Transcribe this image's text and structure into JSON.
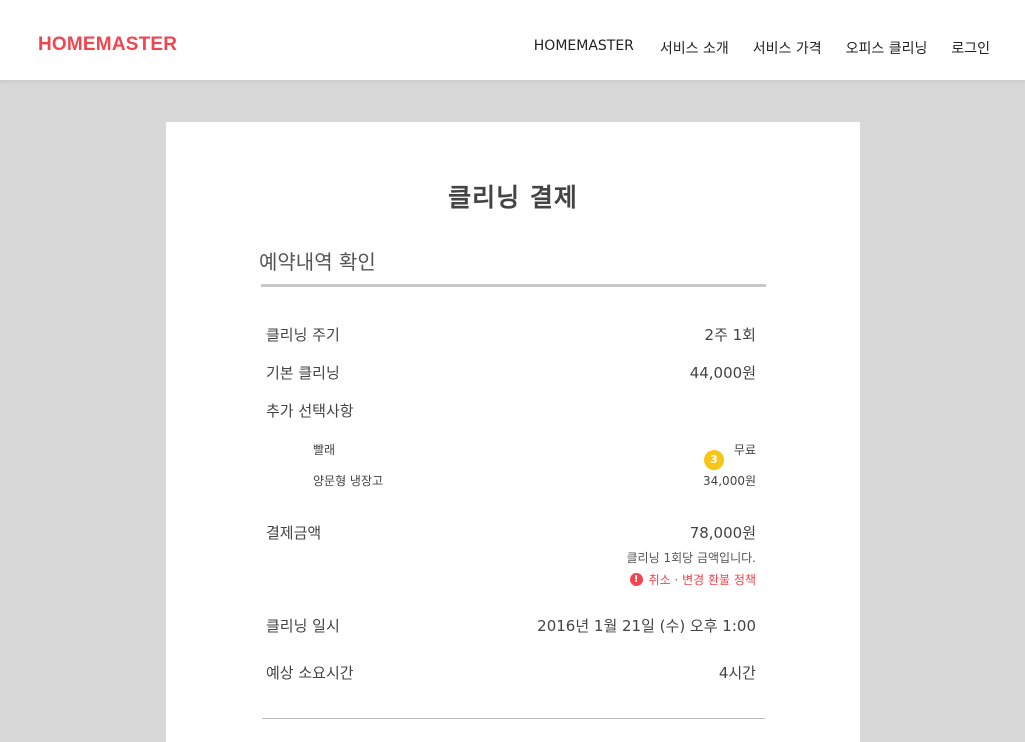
{
  "header": {
    "logo": "HOMEMASTER",
    "nav": [
      "HOMEMASTER",
      "서비스 소개",
      "서비스 가격",
      "오피스 클리닝",
      "로그인"
    ]
  },
  "page": {
    "title": "클리닝 결제",
    "section_title": "예약내역 확인"
  },
  "details": {
    "cycle_label": "클리닝 주기",
    "cycle_value": "2주 1회",
    "basic_label": "기본 클리닝",
    "basic_value": "44,000원",
    "options_label": "추가 선택사항",
    "options": [
      {
        "label": "빨래",
        "value": "무료"
      },
      {
        "label": "양문형 냉장고",
        "value": "34,000원"
      }
    ],
    "badge": "3",
    "total_label": "결제금액",
    "total_value": "78,000원",
    "total_note": "클리닝 1회당 금액입니다.",
    "policy_icon": "!",
    "policy_link": "취소 · 변경 환불 정책",
    "date_label": "클리닝 일시",
    "date_value": "2016년 1월 21일 (수) 오후 1:00",
    "duration_label": "예상 소요시간",
    "duration_value": "4시간"
  },
  "colors": {
    "brand": "#f0464f",
    "badge": "#f5c518",
    "background": "#d8d8d8"
  },
  "icons": {
    "policy": "exclamation-circle-icon",
    "badge": "notification-badge"
  }
}
